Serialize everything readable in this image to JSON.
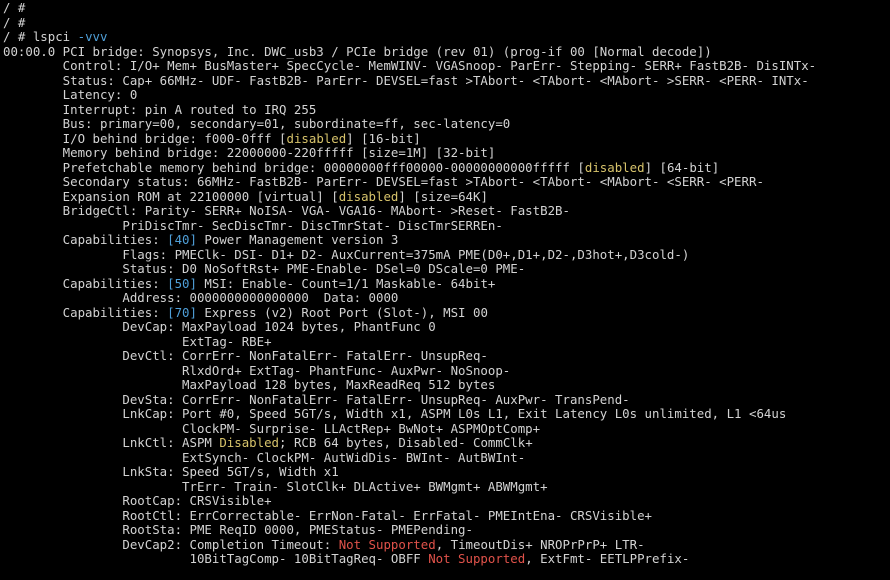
{
  "terminal": {
    "lines": [
      [
        {
          "t": "/ #"
        }
      ],
      [
        {
          "t": "/ #"
        }
      ],
      [
        {
          "t": "/ # lspci "
        },
        {
          "t": "-vvv",
          "c": "blue"
        }
      ],
      [
        {
          "t": "00:00.0 PCI bridge: Synopsys, Inc. DWC_usb3 / PCIe bridge (rev 01) (prog-if 00 [Normal decode])"
        }
      ],
      [
        {
          "t": "        Control: I/O+ Mem+ BusMaster+ SpecCycle- MemWINV- VGASnoop- ParErr- Stepping- SERR+ FastB2B- DisINTx-"
        }
      ],
      [
        {
          "t": "        Status: Cap+ 66MHz- UDF- FastB2B- ParErr- DEVSEL=fast >TAbort- <TAbort- <MAbort- >SERR- <PERR- INTx-"
        }
      ],
      [
        {
          "t": "        Latency: 0"
        }
      ],
      [
        {
          "t": "        Interrupt: pin A routed to IRQ 255"
        }
      ],
      [
        {
          "t": "        Bus: primary=00, secondary=01, subordinate=ff, sec-latency=0"
        }
      ],
      [
        {
          "t": "        I/O behind bridge: f000-0fff ["
        },
        {
          "t": "disabled",
          "c": "yellow"
        },
        {
          "t": "] [16-bit]"
        }
      ],
      [
        {
          "t": "        Memory behind bridge: 22000000-220fffff [size=1M] [32-bit]"
        }
      ],
      [
        {
          "t": "        Prefetchable memory behind bridge: 00000000fff00000-00000000000fffff ["
        },
        {
          "t": "disabled",
          "c": "yellow"
        },
        {
          "t": "] [64-bit]"
        }
      ],
      [
        {
          "t": "        Secondary status: 66MHz- FastB2B- ParErr- DEVSEL=fast >TAbort- <TAbort- <MAbort- <SERR- <PERR-"
        }
      ],
      [
        {
          "t": "        Expansion ROM at 22100000 [virtual] ["
        },
        {
          "t": "disabled",
          "c": "yellow"
        },
        {
          "t": "] [size=64K]"
        }
      ],
      [
        {
          "t": "        BridgeCtl: Parity- SERR+ NoISA- VGA- VGA16- MAbort- >Reset- FastB2B-"
        }
      ],
      [
        {
          "t": "                PriDiscTmr- SecDiscTmr- DiscTmrStat- DiscTmrSERREn-"
        }
      ],
      [
        {
          "t": "        Capabilities: "
        },
        {
          "t": "[40]",
          "c": "blue"
        },
        {
          "t": " Power Management version 3"
        }
      ],
      [
        {
          "t": "                Flags: PMEClk- DSI- D1+ D2- AuxCurrent=375mA PME(D0+,D1+,D2-,D3hot+,D3cold-)"
        }
      ],
      [
        {
          "t": "                Status: D0 NoSoftRst+ PME-Enable- DSel=0 DScale=0 PME-"
        }
      ],
      [
        {
          "t": "        Capabilities: "
        },
        {
          "t": "[50]",
          "c": "blue"
        },
        {
          "t": " MSI: Enable- Count=1/1 Maskable- 64bit+"
        }
      ],
      [
        {
          "t": "                Address: 0000000000000000  Data: 0000"
        }
      ],
      [
        {
          "t": "        Capabilities: "
        },
        {
          "t": "[70]",
          "c": "blue"
        },
        {
          "t": " Express (v2) Root Port (Slot-), MSI 00"
        }
      ],
      [
        {
          "t": "                DevCap: MaxPayload 1024 bytes, PhantFunc 0"
        }
      ],
      [
        {
          "t": "                        ExtTag- RBE+"
        }
      ],
      [
        {
          "t": "                DevCtl: CorrErr- NonFatalErr- FatalErr- UnsupReq-"
        }
      ],
      [
        {
          "t": "                        RlxdOrd+ ExtTag- PhantFunc- AuxPwr- NoSnoop-"
        }
      ],
      [
        {
          "t": "                        MaxPayload 128 bytes, MaxReadReq 512 bytes"
        }
      ],
      [
        {
          "t": "                DevSta: CorrErr- NonFatalErr- FatalErr- UnsupReq- AuxPwr- TransPend-"
        }
      ],
      [
        {
          "t": "                LnkCap: Port #0, Speed 5GT/s, Width x1, ASPM L0s L1, Exit Latency L0s unlimited, L1 <64us"
        }
      ],
      [
        {
          "t": "                        ClockPM- Surprise- LLActRep+ BwNot+ ASPMOptComp+"
        }
      ],
      [
        {
          "t": "                LnkCtl: ASPM "
        },
        {
          "t": "Disabled",
          "c": "yellow"
        },
        {
          "t": "; RCB 64 bytes, Disabled- CommClk+"
        }
      ],
      [
        {
          "t": "                        ExtSynch- ClockPM- AutWidDis- BWInt- AutBWInt-"
        }
      ],
      [
        {
          "t": "                LnkSta: Speed 5GT/s, Width x1"
        }
      ],
      [
        {
          "t": "                        TrErr- Train- SlotClk+ DLActive+ BWMgmt+ ABWMgmt+"
        }
      ],
      [
        {
          "t": "                RootCap: CRSVisible+"
        }
      ],
      [
        {
          "t": "                RootCtl: ErrCorrectable- ErrNon-Fatal- ErrFatal- PMEIntEna- CRSVisible+"
        }
      ],
      [
        {
          "t": "                RootSta: PME ReqID 0000, PMEStatus- PMEPending-"
        }
      ],
      [
        {
          "t": "                DevCap2: Completion Timeout: "
        },
        {
          "t": "Not Supported",
          "c": "red"
        },
        {
          "t": ", TimeoutDis+ NROPrPrP+ LTR-"
        }
      ],
      [
        {
          "t": "                         10BitTagComp- 10BitTagReq- OBFF "
        },
        {
          "t": "Not Supported",
          "c": "red"
        },
        {
          "t": ", ExtFmt- EETLPPrefix-"
        }
      ]
    ]
  },
  "colors": {
    "background": "#000000",
    "foreground": "#d3d3d3",
    "yellow": "#d7c36b",
    "blue": "#4f9fd8",
    "red": "#e0524a"
  }
}
